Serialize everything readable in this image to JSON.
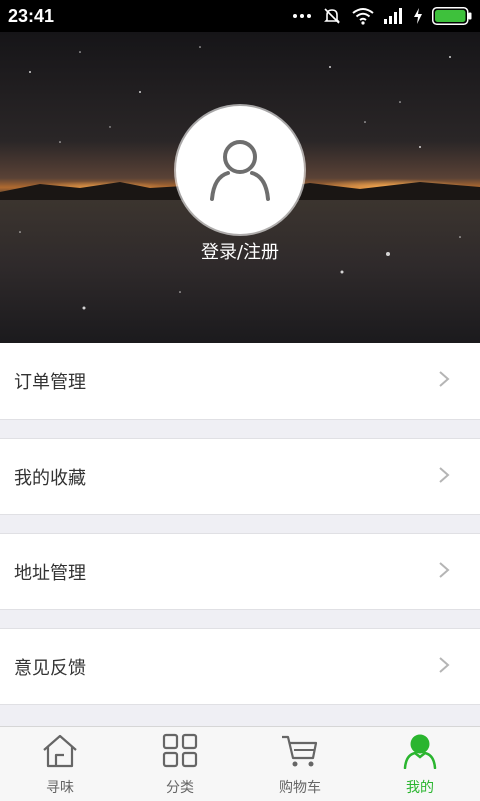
{
  "status_bar": {
    "time": "23:41"
  },
  "header": {
    "login_label": "登录/注册"
  },
  "menu": {
    "items": [
      {
        "label": "订单管理"
      },
      {
        "label": "我的收藏"
      },
      {
        "label": "地址管理"
      },
      {
        "label": "意见反馈"
      }
    ]
  },
  "tabbar": {
    "items": [
      {
        "label": "寻味",
        "icon": "home-icon"
      },
      {
        "label": "分类",
        "icon": "grid-icon"
      },
      {
        "label": "购物车",
        "icon": "cart-icon"
      },
      {
        "label": "我的",
        "icon": "user-icon",
        "active": true
      }
    ]
  },
  "colors": {
    "accent": "#2ab52f",
    "page_bg": "#efeff4",
    "text": "#333333",
    "chevron": "#b5b5b5"
  }
}
